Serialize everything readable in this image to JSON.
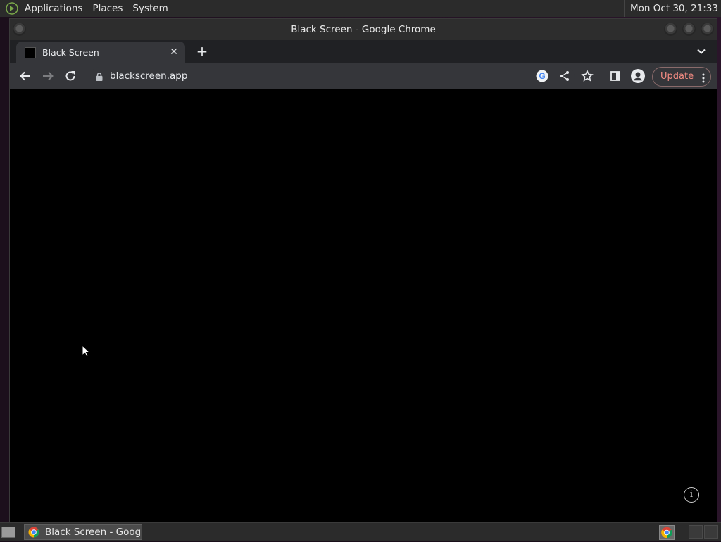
{
  "top_panel": {
    "menus": [
      "Applications",
      "Places",
      "System"
    ],
    "clock": "Mon Oct 30, 21:33"
  },
  "window": {
    "title": "Black Screen - Google Chrome"
  },
  "browser": {
    "tab": {
      "title": "Black Screen"
    },
    "url": "blackscreen.app",
    "update_label": "Update"
  },
  "content": {
    "info_glyph": "i",
    "background_color": "#000000"
  },
  "taskbar": {
    "task_label": "Black Screen - Goog..."
  },
  "colors": {
    "update_text": "#f28b82",
    "toolbar": "#35363a",
    "tabbar": "#202124"
  }
}
